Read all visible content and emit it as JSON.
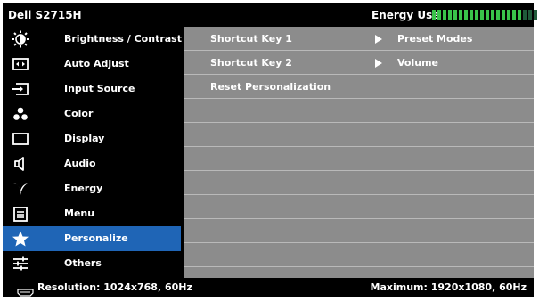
{
  "header": {
    "model": "Dell S2715H",
    "energy_label": "Energy Use",
    "energy_level": 0.81
  },
  "colors": {
    "selected": "#1f65b6",
    "submenu_bg": "#8c8c8c",
    "energy_on": "#39c34a",
    "energy_off": "#1f5a3a"
  },
  "menu": {
    "items": [
      {
        "label": "Brightness / Contrast",
        "icon": "brightness-icon"
      },
      {
        "label": "Auto Adjust",
        "icon": "auto-adjust-icon"
      },
      {
        "label": "Input Source",
        "icon": "input-source-icon"
      },
      {
        "label": "Color",
        "icon": "color-icon"
      },
      {
        "label": "Display",
        "icon": "display-icon"
      },
      {
        "label": "Audio",
        "icon": "audio-icon"
      },
      {
        "label": "Energy",
        "icon": "energy-icon"
      },
      {
        "label": "Menu",
        "icon": "menu-icon"
      },
      {
        "label": "Personalize",
        "icon": "star-icon",
        "selected": true
      },
      {
        "label": "Others",
        "icon": "others-icon"
      }
    ]
  },
  "submenu": {
    "rows": [
      {
        "label": "Shortcut Key 1",
        "value": "Preset Modes"
      },
      {
        "label": "Shortcut Key 2",
        "value": "Volume"
      },
      {
        "label": "Reset Personalization",
        "value": ""
      },
      {
        "label": "",
        "value": ""
      },
      {
        "label": "",
        "value": ""
      },
      {
        "label": "",
        "value": ""
      },
      {
        "label": "",
        "value": ""
      },
      {
        "label": "",
        "value": ""
      },
      {
        "label": "",
        "value": ""
      },
      {
        "label": "",
        "value": ""
      }
    ]
  },
  "footer": {
    "resolution": "Resolution: 1024x768, 60Hz",
    "maximum": "Maximum: 1920x1080, 60Hz"
  }
}
